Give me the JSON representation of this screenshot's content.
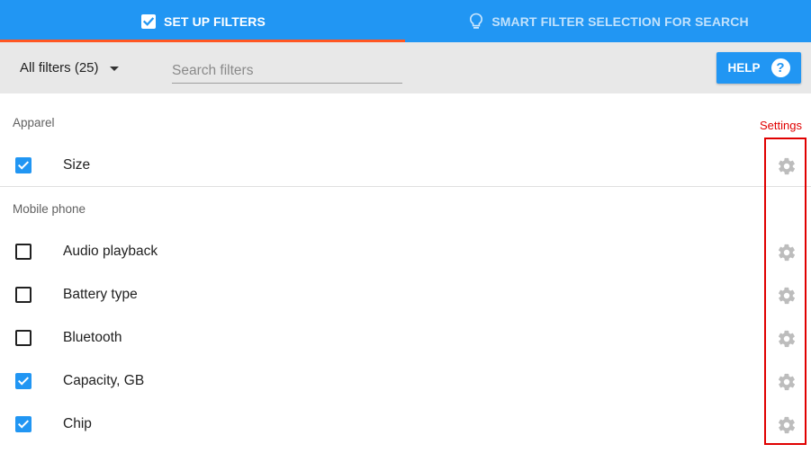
{
  "tabs": [
    {
      "label": "SET UP FILTERS",
      "icon": "checkbox-checked-icon",
      "active": true
    },
    {
      "label": "SMART FILTER SELECTION FOR SEARCH",
      "icon": "lightbulb-icon",
      "active": false
    }
  ],
  "toolbar": {
    "filter_dropdown": "All filters (25)",
    "search_placeholder": "Search filters",
    "search_value": "",
    "help_label": "HELP",
    "help_icon": "?"
  },
  "groups": [
    {
      "title": "Apparel",
      "items": [
        {
          "label": "Size",
          "checked": true
        }
      ]
    },
    {
      "title": "Mobile phone",
      "items": [
        {
          "label": "Audio playback",
          "checked": false
        },
        {
          "label": "Battery type",
          "checked": false
        },
        {
          "label": "Bluetooth",
          "checked": false
        },
        {
          "label": "Capacity, GB",
          "checked": true
        },
        {
          "label": "Chip",
          "checked": true
        }
      ]
    }
  ],
  "annotation": {
    "label": "Settings",
    "color": "#e00000"
  },
  "colors": {
    "primary": "#2196f3",
    "tab_indicator": "#ff5722",
    "toolbar_bg": "#e8e8e8",
    "gear": "#bdbdbd"
  }
}
